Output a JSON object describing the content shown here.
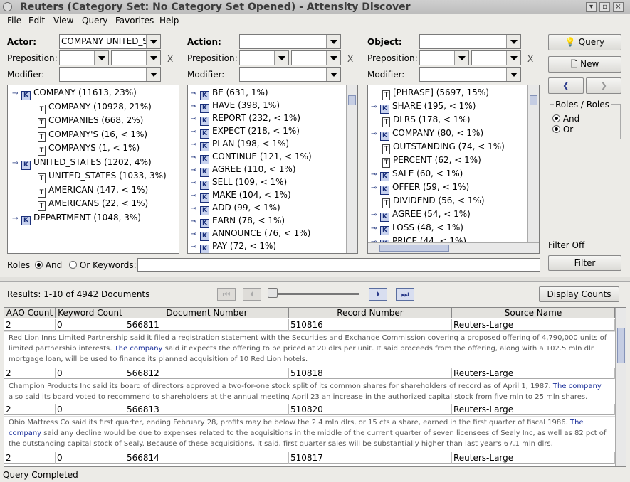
{
  "window": {
    "title": "Reuters (Category Set: No Category Set Opened) - Attensity Discover"
  },
  "menu": [
    "File",
    "Edit",
    "View",
    "Query",
    "Favorites",
    "Help"
  ],
  "actor": {
    "label": "Actor:",
    "value": "COMPANY UNITED_S",
    "preposition_label": "Preposition:",
    "modifier_label": "Modifier:",
    "x": "X"
  },
  "action": {
    "label": "Action:",
    "preposition_label": "Preposition:",
    "modifier_label": "Modifier:",
    "x": "X"
  },
  "object": {
    "label": "Object:",
    "preposition_label": "Preposition:",
    "modifier_label": "Modifier:",
    "x": "X"
  },
  "actor_tree": [
    {
      "text": "COMPANY (11613, 23%)",
      "level": 0,
      "icon": "K",
      "expander": true
    },
    {
      "text": "COMPANY (10928, 21%)",
      "level": 1,
      "icon": "T"
    },
    {
      "text": "COMPANIES (668, 2%)",
      "level": 1,
      "icon": "T"
    },
    {
      "text": "COMPANY'S (16, < 1%)",
      "level": 1,
      "icon": "T"
    },
    {
      "text": "COMPANYS (1, < 1%)",
      "level": 1,
      "icon": "T"
    },
    {
      "text": "UNITED_STATES (1202, 4%)",
      "level": 0,
      "icon": "K",
      "expander": true
    },
    {
      "text": "UNITED_STATES (1033, 3%)",
      "level": 1,
      "icon": "T"
    },
    {
      "text": "AMERICAN (147, < 1%)",
      "level": 1,
      "icon": "T"
    },
    {
      "text": "AMERICANS (22, < 1%)",
      "level": 1,
      "icon": "T"
    },
    {
      "text": "DEPARTMENT (1048, 3%)",
      "level": 0,
      "icon": "K",
      "expander": true
    }
  ],
  "action_tree": [
    "BE (631, 1%)",
    "HAVE (398, 1%)",
    "REPORT (232, < 1%)",
    "EXPECT (218, < 1%)",
    "PLAN (198, < 1%)",
    "CONTINUE (121, < 1%)",
    "AGREE (110, < 1%)",
    "SELL (109, < 1%)",
    "MAKE (104, < 1%)",
    "ADD (99, < 1%)",
    "EARN (78, < 1%)",
    "ANNOUNCE (76, < 1%)",
    "PAY (72, < 1%)"
  ],
  "object_tree": [
    {
      "text": "[PHRASE] (5697, 15%)",
      "icon": "T",
      "expander": false
    },
    {
      "text": "SHARE (195, < 1%)",
      "icon": "K",
      "expander": true
    },
    {
      "text": "DLRS (178, < 1%)",
      "icon": "T",
      "expander": false
    },
    {
      "text": "COMPANY (80, < 1%)",
      "icon": "K",
      "expander": true
    },
    {
      "text": "OUTSTANDING (74, < 1%)",
      "icon": "T",
      "expander": false
    },
    {
      "text": "PERCENT (62, < 1%)",
      "icon": "T",
      "expander": false
    },
    {
      "text": "SALE (60, < 1%)",
      "icon": "K",
      "expander": true
    },
    {
      "text": "OFFER (59, < 1%)",
      "icon": "K",
      "expander": true
    },
    {
      "text": "DIVIDEND (56, < 1%)",
      "icon": "T",
      "expander": false
    },
    {
      "text": "AGREE (54, < 1%)",
      "icon": "K",
      "expander": true
    },
    {
      "text": "LOSS (48, < 1%)",
      "icon": "K",
      "expander": true
    },
    {
      "text": "PRICE (44, < 1%)",
      "icon": "K",
      "expander": true
    }
  ],
  "buttons": {
    "query": "Query",
    "new": "New",
    "filter": "Filter",
    "display_counts": "Display Counts"
  },
  "roles_group": {
    "title": "Roles / Roles",
    "and": "And",
    "or": "Or"
  },
  "filter_status": "Filter Off",
  "roles_row": {
    "label": "Roles",
    "and": "And",
    "or": "Or",
    "keywords": "Keywords:"
  },
  "results": {
    "label": "Results: 1-10 of 4942 Documents"
  },
  "table": {
    "columns": [
      "AAO Count",
      "Keyword Count",
      "Document Number",
      "Record Number",
      "Source Name"
    ],
    "rows": [
      {
        "aao": "2",
        "kw": "0",
        "doc": "566811",
        "rec": "510816",
        "src": "Reuters-Large",
        "snippet": [
          {
            "t": "Red Lion Inns Limited Partnership said it filed a registration statement with the Securities and Exchange Commission covering a proposed offering of 4,790,000 units of limited partnership interests. "
          },
          {
            "t": "The company",
            "h": true
          },
          {
            "t": " said it expects the offering to be priced at 20 dlrs per unit.  It said proceeds from the offering, along with a 102.5 mln dlr mortgage loan, will be used to finance its planned acquisition of 10 Red Lion hotels."
          }
        ]
      },
      {
        "aao": "2",
        "kw": "0",
        "doc": "566812",
        "rec": "510818",
        "src": "Reuters-Large",
        "snippet": [
          {
            "t": "Champion Products Inc said its board of directors approved a two-for-one stock split of its common shares for shareholders of record as of April 1, 1987.  "
          },
          {
            "t": "The company",
            "h": true
          },
          {
            "t": " also said its board voted to recommend to shareholders at the annual meeting April 23 an increase in the authorized capital stock from five mln to 25 mln shares."
          }
        ]
      },
      {
        "aao": "2",
        "kw": "0",
        "doc": "566813",
        "rec": "510820",
        "src": "Reuters-Large",
        "snippet": [
          {
            "t": "Ohio Mattress Co said its first quarter, ending February 28, profits may be below the 2.4 mln dlrs, or 15 cts a share, earned in the first quarter of fiscal 1986.  "
          },
          {
            "t": "The company",
            "h": true
          },
          {
            "t": " said any decline would be due to expenses related to the acquisitions in the middle of the current quarter of seven licensees of Sealy Inc, as well as 82 pct of the outstanding capital stock of Sealy.  Because of these acquisitions, it said, first quarter sales will be substantially higher than last year's 67.1 mln dlrs."
          }
        ]
      },
      {
        "aao": "2",
        "kw": "0",
        "doc": "566814",
        "rec": "510817",
        "src": "Reuters-Large",
        "snippet": []
      }
    ]
  },
  "status": "Query Completed"
}
